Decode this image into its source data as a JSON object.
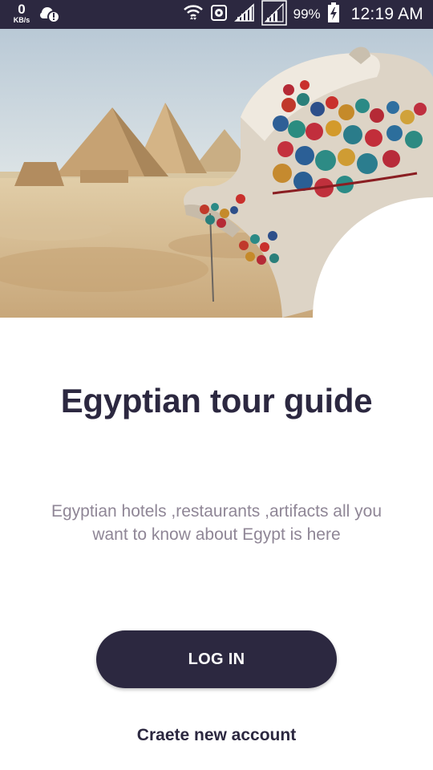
{
  "status_bar": {
    "net_speed_value": "0",
    "net_speed_unit": "KB/s",
    "battery_percent": "99%",
    "time": "12:19 AM"
  },
  "hero": {
    "image": "pyramids-camel-photo"
  },
  "main": {
    "title": "Egyptian tour guide",
    "subtitle": "Egyptian hotels ,restaurants ,artifacts all you want to know about Egypt is here"
  },
  "actions": {
    "login_label": "LOG IN",
    "create_account_label": "Craete new account"
  },
  "colors": {
    "primary": "#2c2840",
    "subtitle": "#8f8696",
    "background": "#ffffff"
  }
}
